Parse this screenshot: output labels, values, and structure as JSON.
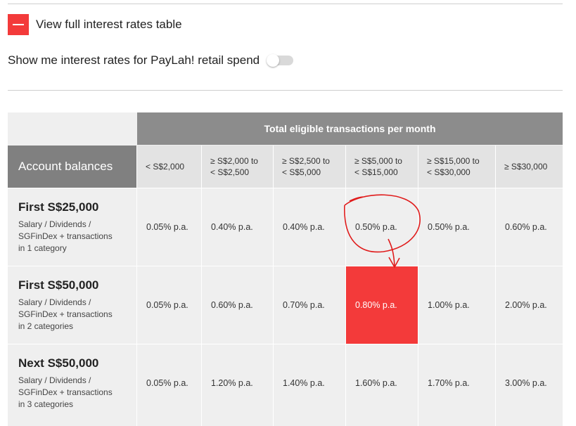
{
  "view_toggle": {
    "label": "View full interest rates table"
  },
  "paylah": {
    "label": "Show me interest rates for PayLah! retail spend",
    "enabled": false
  },
  "table": {
    "top_header": "Total eligible transactions per month",
    "account_header": "Account balances",
    "columns": [
      "< S$2,000",
      "≥ S$2,000 to\n< S$2,500",
      "≥ S$2,500 to\n< S$5,000",
      "≥ S$5,000 to\n< S$15,000",
      "≥ S$15,000 to\n< S$30,000",
      "≥ S$30,000"
    ],
    "rows": [
      {
        "title": "First S$25,000",
        "desc": "Salary / Dividends /\nSGFinDex + transactions\nin 1 category",
        "values": [
          "0.05% p.a.",
          "0.40% p.a.",
          "0.40% p.a.",
          "0.50% p.a.",
          "0.50% p.a.",
          "0.60% p.a."
        ]
      },
      {
        "title": "First S$50,000",
        "desc": "Salary / Dividends /\nSGFinDex + transactions\nin 2 categories",
        "values": [
          "0.05% p.a.",
          "0.60% p.a.",
          "0.70% p.a.",
          "0.80% p.a.",
          "1.00% p.a.",
          "2.00% p.a."
        ]
      },
      {
        "title": "Next S$50,000",
        "desc": "Salary / Dividends /\nSGFinDex + transactions\nin 3 categories",
        "values": [
          "0.05% p.a.",
          "1.20% p.a.",
          "1.40% p.a.",
          "1.60% p.a.",
          "1.70% p.a.",
          "3.00% p.a."
        ]
      }
    ],
    "highlight": {
      "row": 1,
      "col": 3
    },
    "highlight_color": "#f33a3a"
  }
}
